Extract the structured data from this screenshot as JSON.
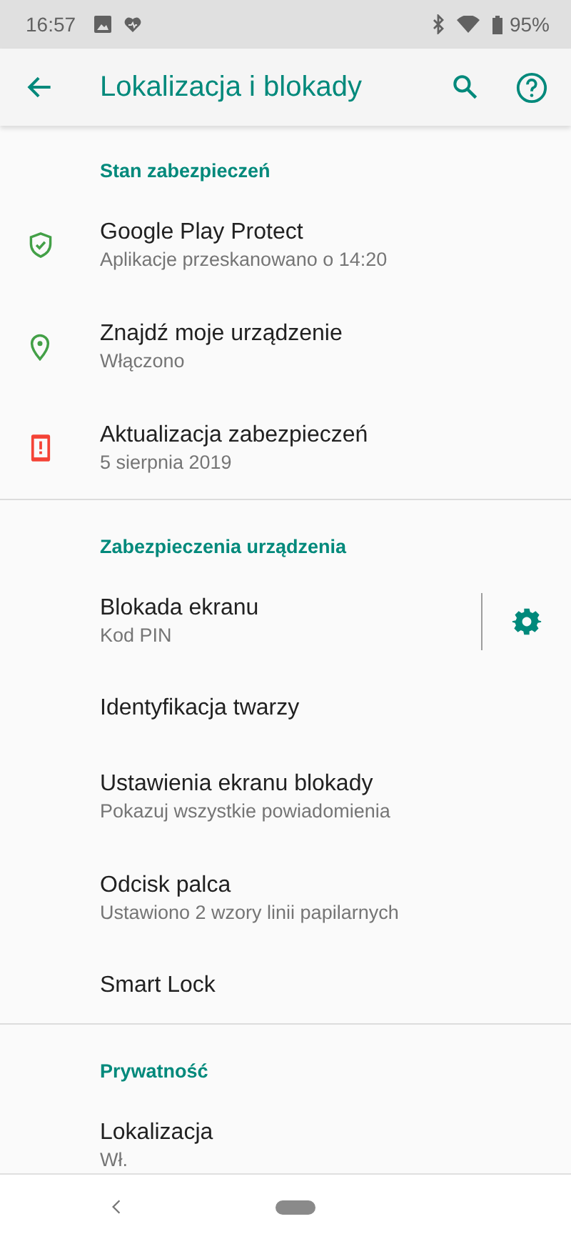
{
  "status_bar": {
    "time": "16:57",
    "battery": "95%"
  },
  "app_bar": {
    "title": "Lokalizacja i blokady"
  },
  "sections": [
    {
      "title": "Stan zabezpieczeń",
      "items": [
        {
          "title": "Google Play Protect",
          "subtitle": "Aplikacje przeskanowano o 14:20",
          "color": "#43a047"
        },
        {
          "title": "Znajdź moje urządzenie",
          "subtitle": "Włączono",
          "color": "#43a047"
        },
        {
          "title": "Aktualizacja zabezpieczeń",
          "subtitle": "5 sierpnia 2019",
          "color": "#f44336"
        }
      ]
    },
    {
      "title": "Zabezpieczenia urządzenia",
      "items": [
        {
          "title": "Blokada ekranu",
          "subtitle": "Kod PIN",
          "settings": true
        },
        {
          "title": "Identyfikacja twarzy"
        },
        {
          "title": "Ustawienia ekranu blokady",
          "subtitle": "Pokazuj wszystkie powiadomienia"
        },
        {
          "title": "Odcisk palca",
          "subtitle": "Ustawiono 2 wzory linii papilarnych"
        },
        {
          "title": "Smart Lock"
        }
      ]
    },
    {
      "title": "Prywatność",
      "items": [
        {
          "title": "Lokalizacja",
          "subtitle": "Wł."
        }
      ]
    }
  ]
}
